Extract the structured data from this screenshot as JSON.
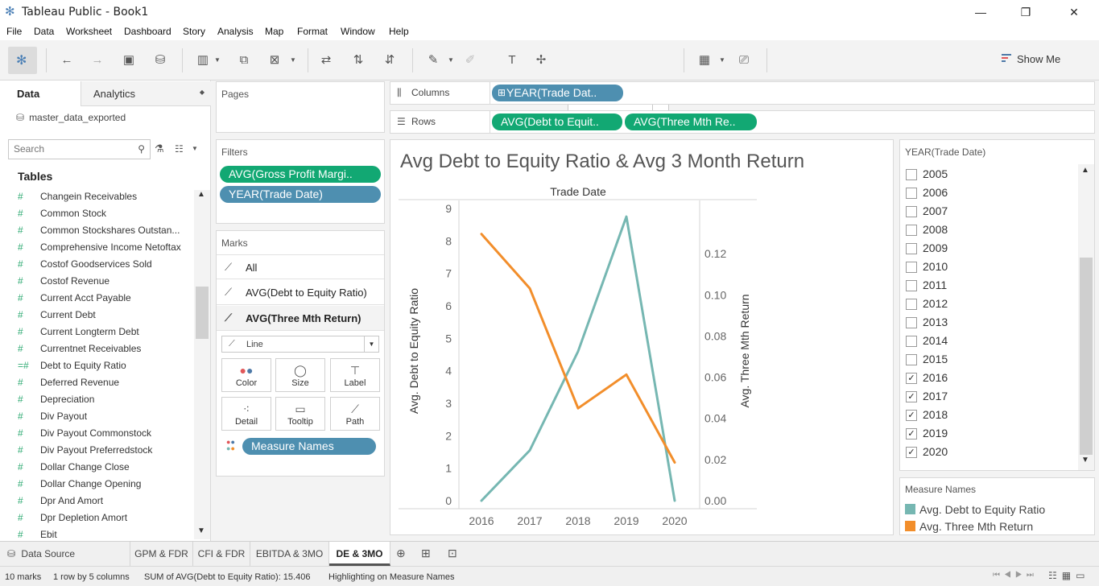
{
  "window": {
    "title": "Tableau Public - Book1",
    "minimize": "—",
    "maximize": "❐",
    "close": "✕"
  },
  "menu": [
    "File",
    "Data",
    "Worksheet",
    "Dashboard",
    "Story",
    "Analysis",
    "Map",
    "Format",
    "Window",
    "Help"
  ],
  "toolbar": {
    "fit_select": "Standard",
    "show_me": "Show Me"
  },
  "data_pane": {
    "tab_data": "Data",
    "tab_analytics": "Analytics",
    "datasource": "master_data_exported",
    "search_placeholder": "Search",
    "tables_header": "Tables",
    "fields": [
      "Changein Receivables",
      "Common Stock",
      "Common Stockshares Outstan...",
      "Comprehensive Income Netoftax",
      "Costof Goodservices Sold",
      "Costof Revenue",
      "Current Acct Payable",
      "Current Debt",
      "Current Longterm Debt",
      "Currentnet Receivables",
      "Debt to Equity Ratio",
      "Deferred Revenue",
      "Depreciation",
      "Div Payout",
      "Div Payout Commonstock",
      "Div Payout Preferredstock",
      "Dollar Change Close",
      "Dollar Change Opening",
      "Dpr And Amort",
      "Dpr Depletion Amort",
      "Ebit"
    ]
  },
  "pages": {
    "title": "Pages"
  },
  "filters": {
    "title": "Filters",
    "pills": [
      "AVG(Gross Profit Margi..",
      "YEAR(Trade Date)"
    ]
  },
  "marks": {
    "title": "Marks",
    "rows": [
      "All",
      "AVG(Debt to Equity Ratio)",
      "AVG(Three Mth Return)"
    ],
    "type": "Line",
    "buttons": [
      "Color",
      "Size",
      "Label",
      "Detail",
      "Tooltip",
      "Path"
    ],
    "measure_names_pill": "Measure Names"
  },
  "columns": {
    "label": "Columns",
    "pill": "YEAR(Trade Dat.."
  },
  "rows": {
    "label": "Rows",
    "pills": [
      "AVG(Debt to Equit..",
      "AVG(Three Mth Re.."
    ]
  },
  "viz": {
    "title": "Avg Debt to Equity Ratio & Avg 3 Month Return"
  },
  "year_filter": {
    "title": "YEAR(Trade Date)",
    "items": [
      {
        "label": "2005",
        "checked": false
      },
      {
        "label": "2006",
        "checked": false
      },
      {
        "label": "2007",
        "checked": false
      },
      {
        "label": "2008",
        "checked": false
      },
      {
        "label": "2009",
        "checked": false
      },
      {
        "label": "2010",
        "checked": false
      },
      {
        "label": "2011",
        "checked": false
      },
      {
        "label": "2012",
        "checked": false
      },
      {
        "label": "2013",
        "checked": false
      },
      {
        "label": "2014",
        "checked": false
      },
      {
        "label": "2015",
        "checked": false
      },
      {
        "label": "2016",
        "checked": true
      },
      {
        "label": "2017",
        "checked": true
      },
      {
        "label": "2018",
        "checked": true
      },
      {
        "label": "2019",
        "checked": true
      },
      {
        "label": "2020",
        "checked": true
      }
    ]
  },
  "legend": {
    "title": "Measure Names",
    "items": [
      {
        "label": "Avg. Debt to Equity Ratio",
        "color": "#76b7b2"
      },
      {
        "label": "Avg. Three Mth Return",
        "color": "#f28e2b"
      }
    ]
  },
  "sheet_tabs": {
    "datasource": "Data Source",
    "tabs": [
      "GPM & FDR",
      "CFI & FDR",
      "EBITDA & 3MO",
      "DE & 3MO"
    ],
    "active": "DE & 3MO"
  },
  "status": {
    "marks": "10 marks",
    "dims": "1 row by 5 columns",
    "sum": "SUM of AVG(Debt to Equity Ratio): 15.406",
    "highlight": "Highlighting on Measure Names"
  },
  "chart_data": {
    "type": "line",
    "title": "Avg Debt to Equity Ratio & Avg 3 Month Return",
    "xlabel": "Trade Date",
    "categories": [
      "2016",
      "2017",
      "2018",
      "2019",
      "2020"
    ],
    "series": [
      {
        "name": "Avg. Debt to Equity Ratio",
        "axis": "left",
        "color": "#76b7b2",
        "values": [
          0.0,
          1.55,
          4.6,
          8.75,
          0.0
        ]
      },
      {
        "name": "Avg. Three Mth Return",
        "axis": "right",
        "color": "#f28e2b",
        "values": [
          0.1296,
          0.1032,
          0.0449,
          0.0613,
          0.0186
        ]
      }
    ],
    "y_left": {
      "label": "Avg. Debt to Equity Ratio",
      "range": [
        0,
        9
      ],
      "ticks": [
        "0",
        "1",
        "2",
        "3",
        "4",
        "5",
        "6",
        "7",
        "8",
        "9"
      ]
    },
    "y_right": {
      "label": "Avg. Three Mth Return",
      "range": [
        0,
        0.142
      ],
      "ticks": [
        "0.00",
        "0.02",
        "0.04",
        "0.06",
        "0.08",
        "0.10",
        "0.12"
      ]
    },
    "grid": false
  }
}
